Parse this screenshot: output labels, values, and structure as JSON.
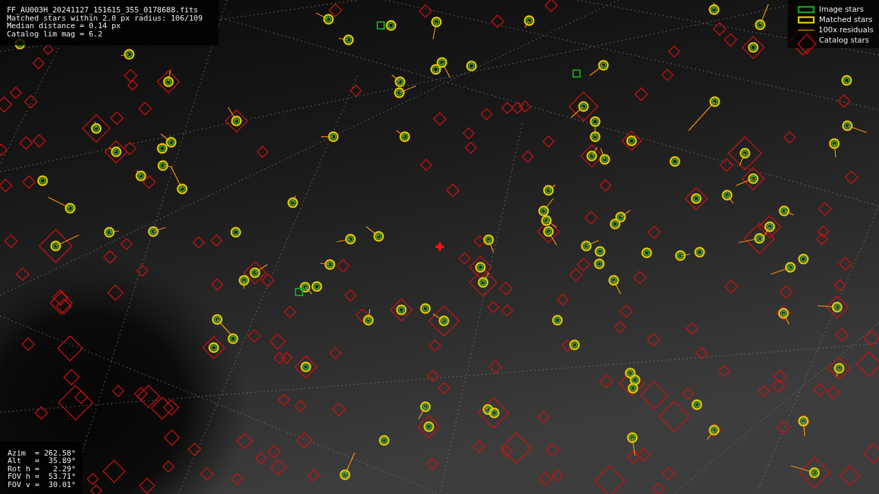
{
  "image_info": {
    "lines": [
      "FF_AU003H_20241127_151615_355_0178688.fits",
      "Matched stars within 2.0 px radius: 106/109",
      "Median distance = 0.14 px",
      "Catalog lim mag = 6.2"
    ]
  },
  "legend": [
    {
      "kind": "image",
      "label": "Image stars"
    },
    {
      "kind": "matched",
      "label": "Matched stars"
    },
    {
      "kind": "residual",
      "label": "100x residuals"
    },
    {
      "kind": "catalog",
      "label": "Catalog stars"
    }
  ],
  "pointing": {
    "lines": [
      "Azim  = 262.58°",
      "Alt   =  35.89°",
      "Rot h =   2.29°",
      "FOV h =  53.71°",
      "FOV v =  30.01°"
    ]
  }
}
